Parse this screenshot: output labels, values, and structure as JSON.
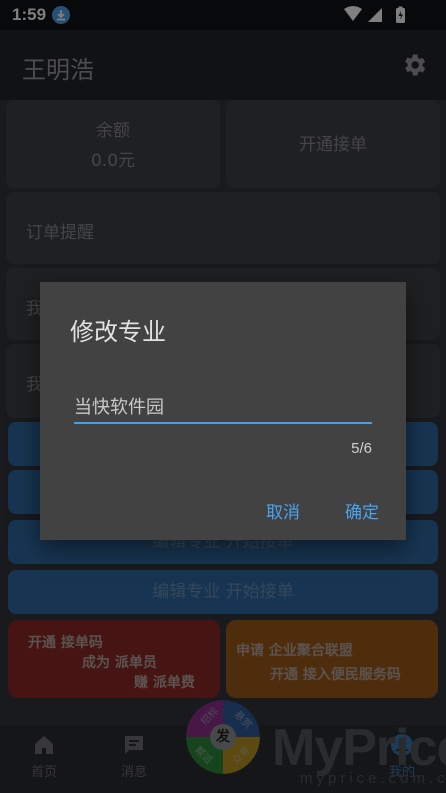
{
  "status_bar": {
    "time": "1:59"
  },
  "app_bar": {
    "title": "王明浩"
  },
  "cards": {
    "balance_label": "余额",
    "balance_value": "0.0元",
    "open_orders": "开通接单",
    "order_reminder": "订单提醒",
    "row_partial_1": "我",
    "row_partial_2": "我"
  },
  "blue_buttons": [
    {
      "label": "编辑专业   开始接单"
    },
    {
      "label": "编辑专业   开始接单"
    }
  ],
  "promos": {
    "red": {
      "line1": "开通 接单码",
      "line2": "成为 派单员",
      "line3": "赚 派单费"
    },
    "orange": {
      "line1": "申请 企业聚合联盟",
      "line2": "开通 接入便民服务码"
    }
  },
  "bottom_nav": {
    "home": "首页",
    "messages": "消息",
    "mine": "我的",
    "wheel_center": "发",
    "wheel_segments": [
      "招标",
      "悬赏",
      "帮派",
      "众筹"
    ]
  },
  "watermark": {
    "main": "MyPrice",
    "sub": "myprice.com.cn"
  },
  "dialog": {
    "title": "修改专业",
    "input_value": "当快软件园",
    "counter": "5/6",
    "cancel": "取消",
    "confirm": "确定"
  },
  "colors": {
    "accent": "#3ea0f0",
    "scrim": "rgba(0,0,0,0.5)"
  }
}
